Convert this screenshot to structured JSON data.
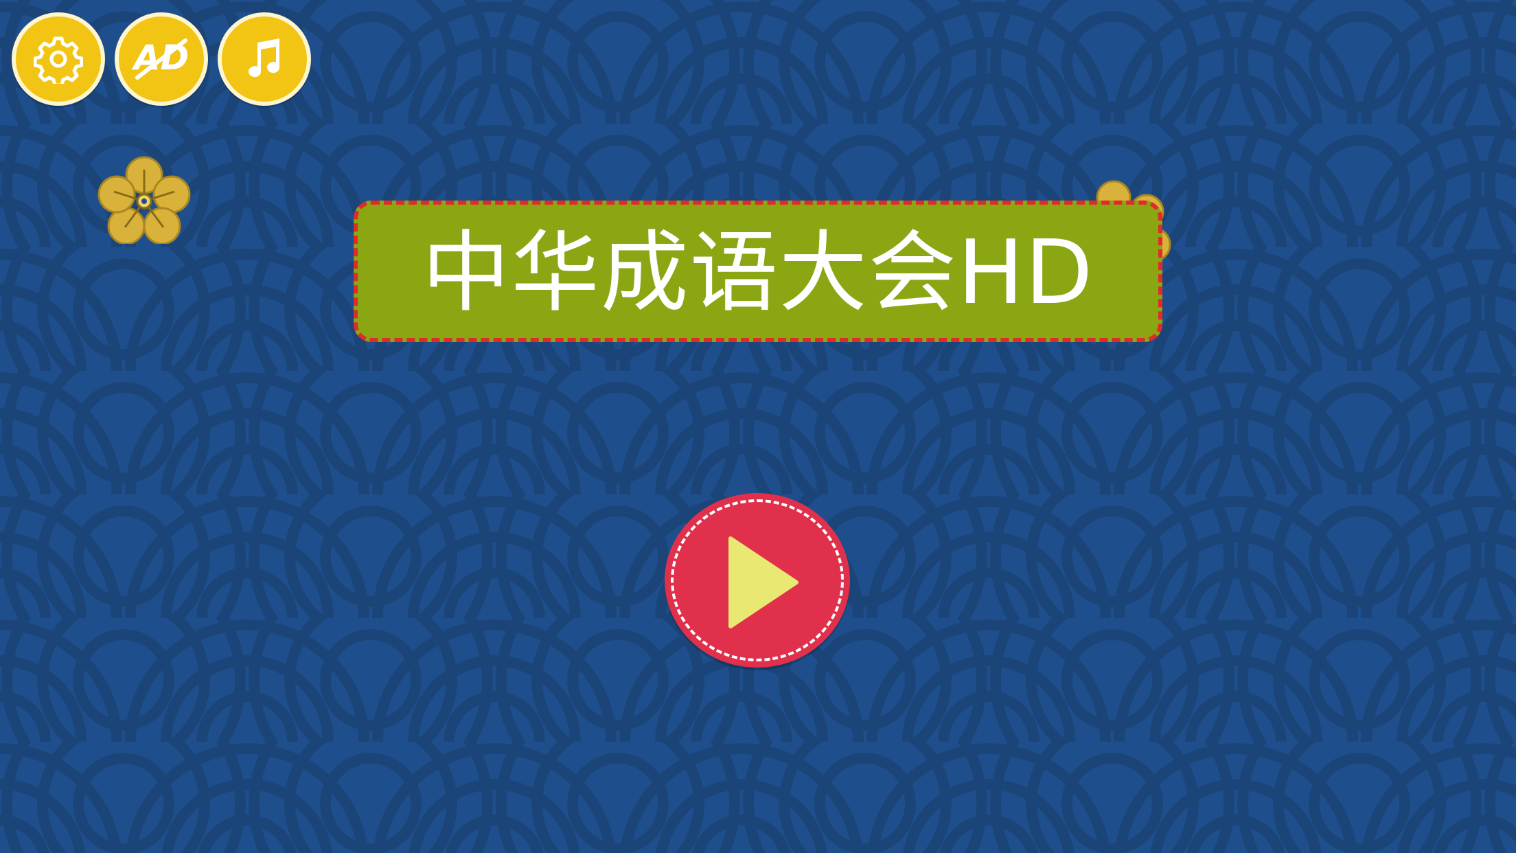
{
  "app": {
    "title": "中华成语大会HD"
  },
  "toolbar": {
    "buttons": [
      {
        "icon": "gear-icon",
        "label": ""
      },
      {
        "icon": "no-ad-icon",
        "label": "AD"
      },
      {
        "icon": "music-note-icon",
        "label": ""
      }
    ]
  },
  "main": {
    "play_icon": "play-icon"
  },
  "colors": {
    "background": "#1e4f8c",
    "pattern": "#1b4679",
    "button_yellow": "#f2c414",
    "button_rim": "#fff6d0",
    "banner_green": "#8aa613",
    "banner_border": "#e02b2b",
    "play_red": "#e0304b",
    "play_triangle": "#e8e873"
  }
}
